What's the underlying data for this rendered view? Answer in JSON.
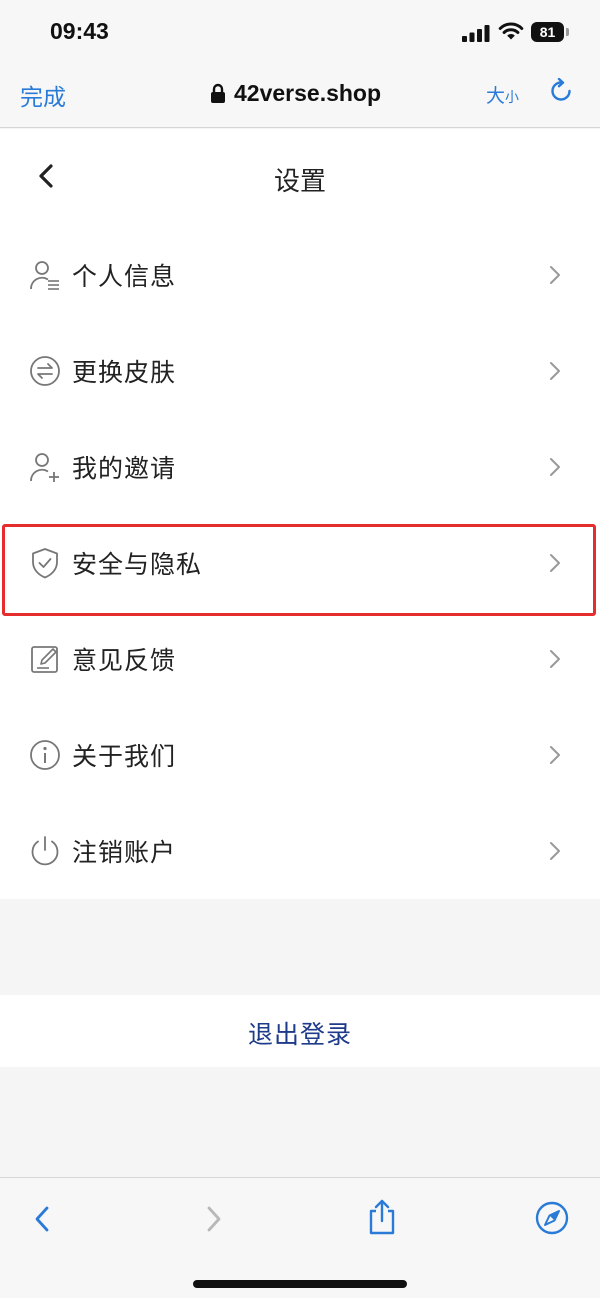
{
  "status_bar": {
    "time": "09:43",
    "battery": "81"
  },
  "browser_bar": {
    "done_label": "完成",
    "url": "42verse.shop",
    "text_size_large": "大",
    "text_size_small": "小",
    "accent_color": "#2a7bd8"
  },
  "page": {
    "title": "设置",
    "menu_items": [
      {
        "label": "个人信息",
        "icon": "user-profile-icon"
      },
      {
        "label": "更换皮肤",
        "icon": "switch-arrows-icon"
      },
      {
        "label": "我的邀请",
        "icon": "user-add-icon"
      },
      {
        "label": "安全与隐私",
        "icon": "shield-check-icon",
        "highlighted": true
      },
      {
        "label": "意见反馈",
        "icon": "feedback-edit-icon"
      },
      {
        "label": "关于我们",
        "icon": "info-icon"
      },
      {
        "label": "注销账户",
        "icon": "power-icon"
      }
    ],
    "logout_label": "退出登录",
    "highlight_color": "#e52d2d"
  },
  "toolbar": {
    "icons": [
      "back-arrow-icon",
      "forward-arrow-icon",
      "share-icon",
      "compass-icon"
    ]
  }
}
